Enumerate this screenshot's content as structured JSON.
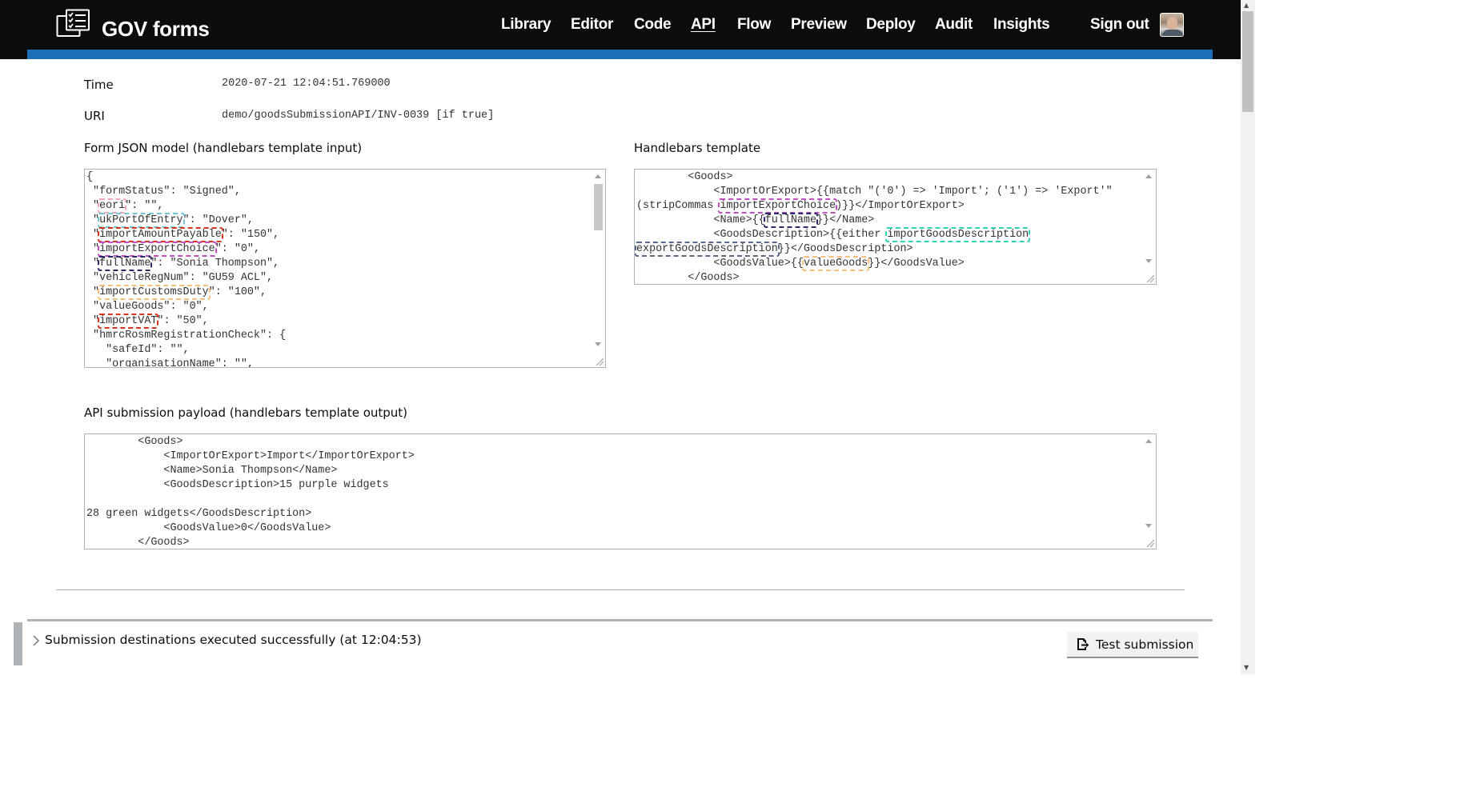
{
  "header": {
    "brand": "GOV forms",
    "nav": [
      {
        "label": "Library",
        "active": false
      },
      {
        "label": "Editor",
        "active": false
      },
      {
        "label": "Code",
        "active": false
      },
      {
        "label": "API",
        "active": true
      },
      {
        "label": "Flow",
        "active": false
      },
      {
        "label": "Preview",
        "active": false
      },
      {
        "label": "Deploy",
        "active": false
      },
      {
        "label": "Audit",
        "active": false
      },
      {
        "label": "Insights",
        "active": false
      }
    ],
    "sign_out": "Sign out"
  },
  "info": {
    "time_label": "Time",
    "time_value": "2020-07-21 12:04:51.769000",
    "uri_label": "URI",
    "uri_value": "demo/goodsSubmissionAPI/INV-0039 [if true]"
  },
  "json_model": {
    "heading": "Form JSON model (handlebars template input)"
  },
  "template": {
    "heading": "Handlebars template"
  },
  "output": {
    "heading": "API submission payload (handlebars template output)"
  },
  "footer": {
    "summary": "Submission destinations executed successfully (at 12:04:53)",
    "test_button": "Test submission"
  },
  "colors": {
    "header_bg": "#0b0c0c",
    "header_bar": "#1d70b8"
  }
}
